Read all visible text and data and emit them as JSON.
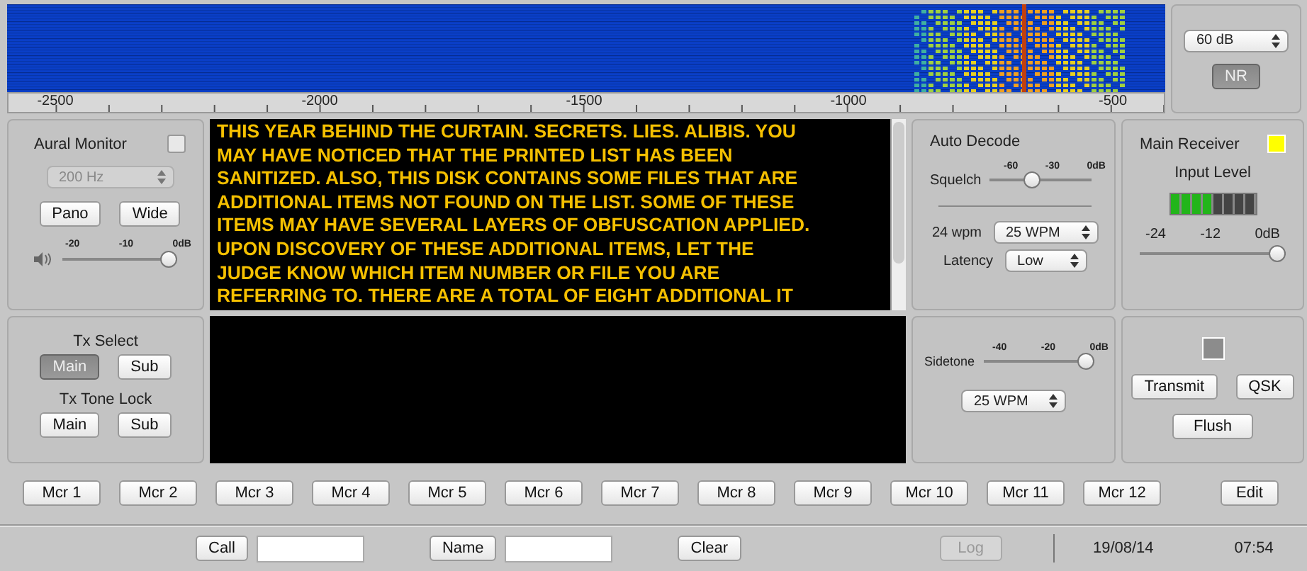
{
  "spectrum": {
    "axis_labels": [
      "-2500",
      "-2000",
      "-1500",
      "-1000",
      "-500"
    ]
  },
  "spectrum_controls": {
    "range": "60 dB",
    "nr_button": {
      "label": "NR",
      "on": true
    }
  },
  "aural_monitor": {
    "label": "Aural Monitor",
    "checked": false,
    "filter": {
      "value": "200 Hz",
      "disabled": true
    },
    "buttons": [
      "Pano",
      "Wide"
    ],
    "volume": {
      "ticks": [
        "-20",
        "-10",
        "0dB"
      ],
      "level": 1
    }
  },
  "decode_lines": [
    "THIS YEAR BEHIND THE CURTAIN. SECRETS. LIES. ALIBIS. YOU",
    "MAY HAVE NOTICED THAT THE PRINTED LIST HAS BEEN",
    "SANITIZED. ALSO, THIS DISK CONTAINS SOME FILES THAT ARE",
    "ADDITIONAL ITEMS NOT FOUND ON THE LIST. SOME OF THESE",
    "ITEMS MAY HAVE SEVERAL LAYERS OF OBFUSCATION APPLIED.",
    "UPON DISCOVERY OF THESE ADDITIONAL ITEMS, LET THE",
    "JUDGE KNOW WHICH ITEM NUMBER OR FILE YOU ARE",
    "REFERRING TO. THERE ARE A TOTAL OF EIGHT ADDITIONAL IT"
  ],
  "auto_decode": {
    "title": "Auto Decode",
    "squelch": {
      "label": "Squelch",
      "ticks": [
        "-60",
        "-30",
        "0dB"
      ],
      "level": 0.4
    },
    "speed": {
      "label": "24 wpm",
      "value": "25 WPM"
    },
    "latency": {
      "label": "Latency",
      "value": "Low"
    }
  },
  "receiver": {
    "label": "Main Receiver",
    "color": "#ffff00",
    "input_label": "Input Level",
    "meter": {
      "level": 0.5
    },
    "slider": {
      "ticks": [
        "-24",
        "-12",
        "0dB"
      ],
      "level": 1
    }
  },
  "tx_select": {
    "label": "Tx Select",
    "options": [
      {
        "label": "Main",
        "selected": true
      },
      {
        "label": "Sub",
        "selected": false
      }
    ]
  },
  "tx_tone_lock": {
    "label": "Tx Tone Lock",
    "options": [
      {
        "label": "Main",
        "selected": false
      },
      {
        "label": "Sub",
        "selected": false
      }
    ]
  },
  "sidetone": {
    "label": "Sidetone",
    "ticks": [
      "-40",
      "-20",
      "0dB"
    ],
    "level": 1,
    "speed": "25 WPM"
  },
  "transmit": {
    "color": "#8c8c8c",
    "buttons": [
      "Transmit",
      "QSK",
      "Flush"
    ]
  },
  "macros": [
    "Mcr 1",
    "Mcr 2",
    "Mcr 3",
    "Mcr 4",
    "Mcr 5",
    "Mcr 6",
    "Mcr 7",
    "Mcr 8",
    "Mcr 9",
    "Mcr 10",
    "Mcr 11",
    "Mcr 12"
  ],
  "edit_button": "Edit",
  "status_bar": {
    "call_button": "Call",
    "name_button": "Name",
    "clear_button": "Clear",
    "log_button": {
      "label": "Log",
      "disabled": true
    },
    "date": "19/08/14",
    "time": "07:54"
  }
}
